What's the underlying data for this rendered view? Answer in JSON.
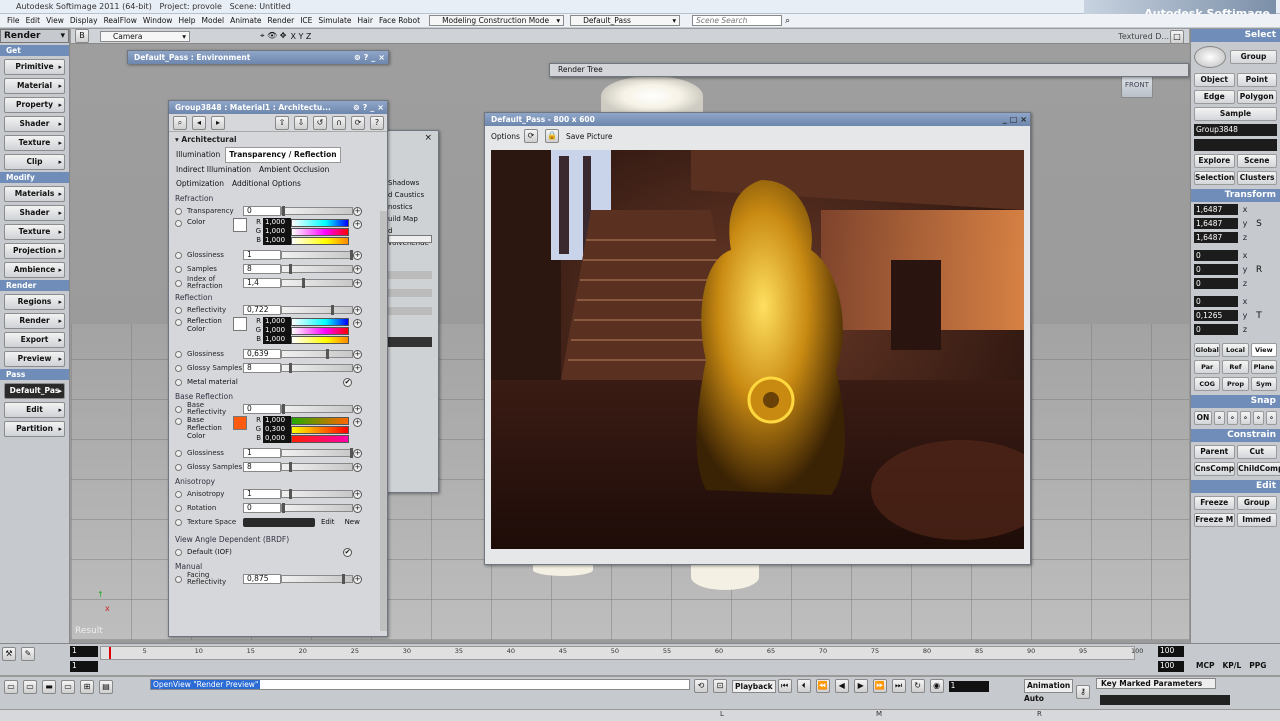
{
  "app": {
    "title": "Autodesk Softimage 2011 (64-bit)",
    "project": "Project: provole",
    "scene": "Scene: Untitled",
    "brand": "Autodesk Softimage"
  },
  "menu": [
    "File",
    "Edit",
    "View",
    "Display",
    "RealFlow",
    "Window",
    "Help",
    "Model",
    "Animate",
    "Render",
    "ICE",
    "Simulate",
    "Hair",
    "Face Robot"
  ],
  "construction_mode": "Modeling Construction Mode",
  "pass_select": "Default_Pass",
  "scene_search_placeholder": "Scene Search",
  "viewport": {
    "camera": "Camera",
    "axes": "X Y Z",
    "shading": "Textured D...",
    "front_label": "FRONT",
    "result_label": "Result"
  },
  "left": {
    "header": "Render",
    "sections": [
      {
        "title": "Get",
        "items": [
          "Primitive",
          "Material",
          "Property",
          "Shader",
          "Texture",
          "Clip"
        ]
      },
      {
        "title": "Modify",
        "items": [
          "Materials",
          "Shader",
          "Texture",
          "Projection",
          "Ambience"
        ]
      },
      {
        "title": "Render",
        "items": [
          "Regions",
          "Render",
          "Export",
          "Preview"
        ]
      },
      {
        "title": "Pass",
        "items": [
          "Default_Pas",
          "Edit",
          "Partition"
        ]
      }
    ]
  },
  "right": {
    "select_title": "Select",
    "group_btn": "Group",
    "modes": [
      "Object",
      "Point",
      "Edge",
      "Polygon",
      "Sample"
    ],
    "selection_name": "Group3848",
    "explore": [
      "Explore",
      "Scene",
      "Selection",
      "Clusters"
    ],
    "transform_title": "Transform",
    "scale": [
      "1,6487",
      "1,6487",
      "1,6487"
    ],
    "rotate": [
      "0",
      "0",
      "0"
    ],
    "translate": [
      "0",
      "0,1265",
      "0"
    ],
    "ref": [
      "Global",
      "Local",
      "View",
      "Par",
      "Ref",
      "Plane",
      "COG",
      "Prop",
      "Sym"
    ],
    "snap_title": "Snap",
    "snap_on": "ON",
    "constrain_title": "Constrain",
    "constrain": [
      "Parent",
      "Cut",
      "CnsComp",
      "ChildComp"
    ],
    "edit_title": "Edit",
    "edit": [
      "Freeze",
      "Group",
      "Freeze M",
      "Immed"
    ]
  },
  "env_window": {
    "title": "Default_Pass : Environment"
  },
  "render_tree": {
    "title": "Render Tree"
  },
  "ppg": {
    "title": "Group3848 : Material1 : Architectu...",
    "shader": "Architectural",
    "tabs_row1": [
      "Illumination",
      "Transparency / Reflection"
    ],
    "tabs_row2": [
      "Indirect Illumination",
      "Ambient Occlusion"
    ],
    "tabs_row3": [
      "Optimization",
      "Additional Options"
    ],
    "refraction": "Refraction",
    "reflection": "Reflection",
    "base_reflection": "Base Reflection",
    "anisotropy": "Anisotropy",
    "brdf": "View Angle Dependent (BRDF)",
    "manual": "Manual",
    "transparency": {
      "label": "Transparency",
      "value": "0",
      "fraction": 0.0
    },
    "color": {
      "label": "Color",
      "r": "1,000",
      "g": "1,000",
      "b": "1,000"
    },
    "glossiness": {
      "label": "Glossiness",
      "value": "1",
      "fraction": 1.0
    },
    "samples": {
      "label": "Samples",
      "value": "8",
      "fraction": 0.1
    },
    "ior": {
      "label": "Index of Refraction",
      "value": "1,4",
      "fraction": 0.3
    },
    "reflectivity": {
      "label": "Reflectivity",
      "value": "0,722",
      "fraction": 0.72
    },
    "refl_color": {
      "label": "Reflection Color",
      "r": "1,000",
      "g": "1,000",
      "b": "1,000"
    },
    "refl_gloss": {
      "label": "Glossiness",
      "value": "0,639",
      "fraction": 0.64
    },
    "glossy_samples": {
      "label": "Glossy Samples",
      "value": "8",
      "fraction": 0.1
    },
    "metal": {
      "label": "Metal material"
    },
    "base_refl": {
      "label": "Base Reflectivity",
      "value": "0",
      "fraction": 0.0
    },
    "base_color": {
      "label": "Base Reflection Color",
      "r": "1,000",
      "g": "0,300",
      "b": "0,000"
    },
    "base_gloss": {
      "label": "Glossiness",
      "value": "1",
      "fraction": 1.0
    },
    "base_glossy_samples": {
      "label": "Glossy Samples",
      "value": "8",
      "fraction": 0.1
    },
    "aniso": {
      "label": "Anisotropy",
      "value": "1",
      "fraction": 0.1
    },
    "rotation": {
      "label": "Rotation",
      "value": "0",
      "fraction": 0.0
    },
    "texspace": {
      "label": "Texture Space",
      "edit": "Edit",
      "new": "New"
    },
    "default_iof": {
      "label": "Default (IOF)"
    },
    "facing": {
      "label": "Facing Reflectivity",
      "value": "0,875",
      "fraction": 0.88
    }
  },
  "behind_window": {
    "items": [
      "Shadows",
      "d Caustics",
      "nostics",
      "uild Map",
      "d",
      "volveRende"
    ]
  },
  "render_window": {
    "title": "Default_Pass - 800 x 600",
    "options": "Options",
    "save": "Save Picture"
  },
  "timeline": {
    "start": "1",
    "end": "100",
    "end2": "100",
    "current": "1",
    "ticks": [
      "5",
      "10",
      "15",
      "20",
      "25",
      "30",
      "35",
      "40",
      "45",
      "50",
      "55",
      "60",
      "65",
      "70",
      "75",
      "80",
      "85",
      "90",
      "95",
      "100"
    ],
    "mcp": "MCP",
    "kp": "KP/L",
    "ppg": "PPG"
  },
  "command": {
    "text": "OpenView \"Render Preview\"",
    "playback": "Playback",
    "frame": "1",
    "animation": "Animation",
    "auto": "Auto",
    "key_marked": "Key Marked Parameters",
    "status_l": "L",
    "status_m": "M",
    "status_r": "R"
  }
}
